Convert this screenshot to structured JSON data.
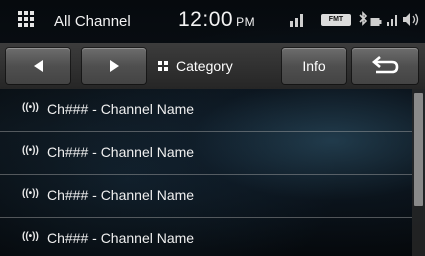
{
  "status": {
    "menu_icon": "grid-menu-icon",
    "title": "All Channel",
    "time": "12:00",
    "ampm": "PM",
    "badge": "FMT",
    "indicators": [
      "signal-icon",
      "format-badge",
      "bluetooth-icon",
      "battery-icon",
      "cell-signal-icon",
      "volume-icon"
    ]
  },
  "toolbar": {
    "prev_icon": "triangle-left-icon",
    "next_icon": "triangle-right-icon",
    "category_label": "Category",
    "info_label": "Info",
    "back_icon": "return-arrow-icon"
  },
  "channels": [
    {
      "icon": "broadcast-icon",
      "label": "Ch### - Channel Name"
    },
    {
      "icon": "broadcast-icon",
      "label": "Ch### - Channel Name"
    },
    {
      "icon": "broadcast-icon",
      "label": "Ch### - Channel Name"
    },
    {
      "icon": "broadcast-icon",
      "label": "Ch### - Channel Name"
    }
  ],
  "colors": {
    "toolbar_button": "#555555",
    "text": "#ffffff",
    "divider": "#aaaaaa",
    "scrollbar_thumb": "#8a8a8a"
  }
}
